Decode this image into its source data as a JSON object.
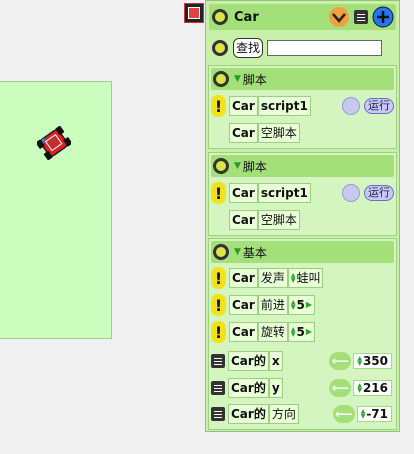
{
  "viewer": {
    "object_name": "Car",
    "search_label": "查找",
    "search_value": "",
    "colors": {
      "accent": "#2277ee",
      "panel": "#c8f0a8",
      "tile": "#e8ffd8"
    }
  },
  "sections": [
    {
      "header": "脚本",
      "rows": [
        {
          "obj": "Car",
          "label": "script1",
          "run": "运行"
        },
        {
          "obj": "Car",
          "label": "空脚本"
        }
      ]
    },
    {
      "header": "脚本",
      "rows": [
        {
          "obj": "Car",
          "label": "script1",
          "run": "运行"
        },
        {
          "obj": "Car",
          "label": "空脚本"
        }
      ]
    },
    {
      "header": "基本",
      "commands": [
        {
          "obj": "Car",
          "cmd": "发声",
          "arg": "蛙叫"
        },
        {
          "obj": "Car",
          "cmd": "前进",
          "arg": "5"
        },
        {
          "obj": "Car",
          "cmd": "旋转",
          "arg": "5"
        }
      ],
      "properties": [
        {
          "obj": "Car的",
          "prop": "x",
          "value": "350"
        },
        {
          "obj": "Car的",
          "prop": "y",
          "value": "216"
        },
        {
          "obj": "Car的",
          "prop": "方向",
          "value": "-71"
        }
      ]
    }
  ]
}
